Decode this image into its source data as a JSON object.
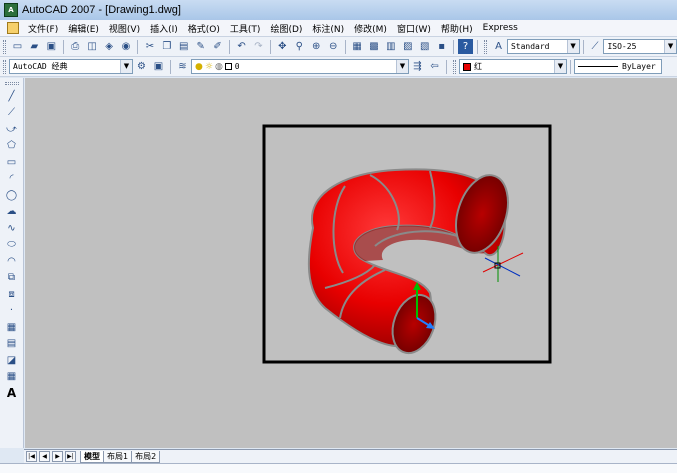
{
  "window": {
    "title": "AutoCAD 2007 - [Drawing1.dwg]"
  },
  "menu": [
    "文件(F)",
    "编辑(E)",
    "视图(V)",
    "插入(I)",
    "格式(O)",
    "工具(T)",
    "绘图(D)",
    "标注(N)",
    "修改(M)",
    "窗口(W)",
    "帮助(H)",
    "Express"
  ],
  "toolbar1": {
    "text_style": "Standard",
    "dim_style": "ISO-25"
  },
  "toolbar2": {
    "workspace": "AutoCAD 经典",
    "layer": "0",
    "color": "红",
    "linetype": "ByLayer"
  },
  "layout_tabs": [
    "模型",
    "布局1",
    "布局2"
  ],
  "colors": {
    "torus": "#e80000",
    "wire": "#8a8a8a",
    "viewport_bg": "#c0c0c0",
    "frame": "#000000"
  }
}
